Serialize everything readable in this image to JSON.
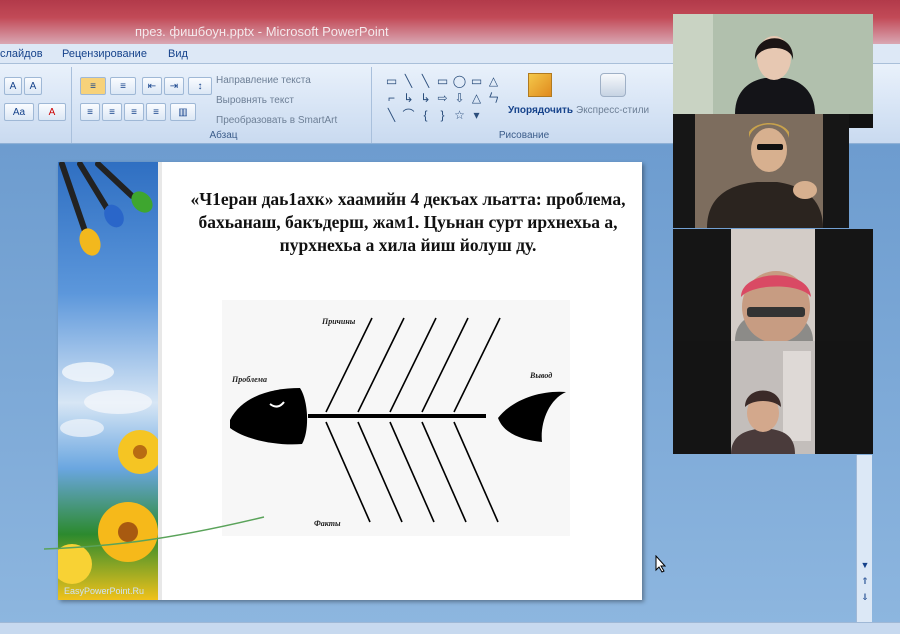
{
  "window": {
    "title": "през. фишбоун.pptx - Microsoft PowerPoint"
  },
  "tabs": [
    "слайдов",
    "Рецензирование",
    "Вид"
  ],
  "ribbon": {
    "font_group": {
      "grow_label": "A",
      "shrink_label": "A",
      "case_label": "Aa",
      "color_label": "A"
    },
    "paragraph": {
      "label": "Абзац",
      "text_direction": "Направление текста",
      "align_text": "Выровнять текст",
      "smartart": "Преобразовать в SmartArt"
    },
    "drawing": {
      "label": "Рисование",
      "arrange": "Упорядочить",
      "quick_styles": "Экспресс-стили",
      "shapes": [
        "▭",
        "╲",
        "╲",
        "▭",
        "◯",
        "▭",
        "△",
        "⌐",
        "↳",
        "↳",
        "⇨",
        "⇩",
        "△",
        "ㄣ",
        "╲",
        "⌒",
        "{",
        "}",
        "☆",
        "▾"
      ]
    }
  },
  "slide": {
    "text": "«Ч1еран даь1ахк» хаамийн 4 декъах льатта: проблема, бахьанаш, бакъдерш, жам1. Цуьнан сурт ирхнехьа а, пурхнехьа а хила йиш йолуш ду.",
    "watermark": "EasyPowerPoint.Ru",
    "fishbone": {
      "problem": "Проблема",
      "causes": "Причины",
      "conclusion": "Вывод",
      "facts": "Факты"
    }
  },
  "participants": [
    {
      "name": "participant-1",
      "bg": "#a7b7a3"
    },
    {
      "name": "participant-2",
      "bg": "#8f8070"
    },
    {
      "name": "participant-3",
      "bg": "#c9c3c0"
    },
    {
      "name": "participant-4",
      "bg": "#b6b2ae"
    }
  ],
  "colors": {
    "titlebar": "#b23a4a",
    "ribbon": "#dde8f6",
    "workspace": "#6d9ccf"
  }
}
